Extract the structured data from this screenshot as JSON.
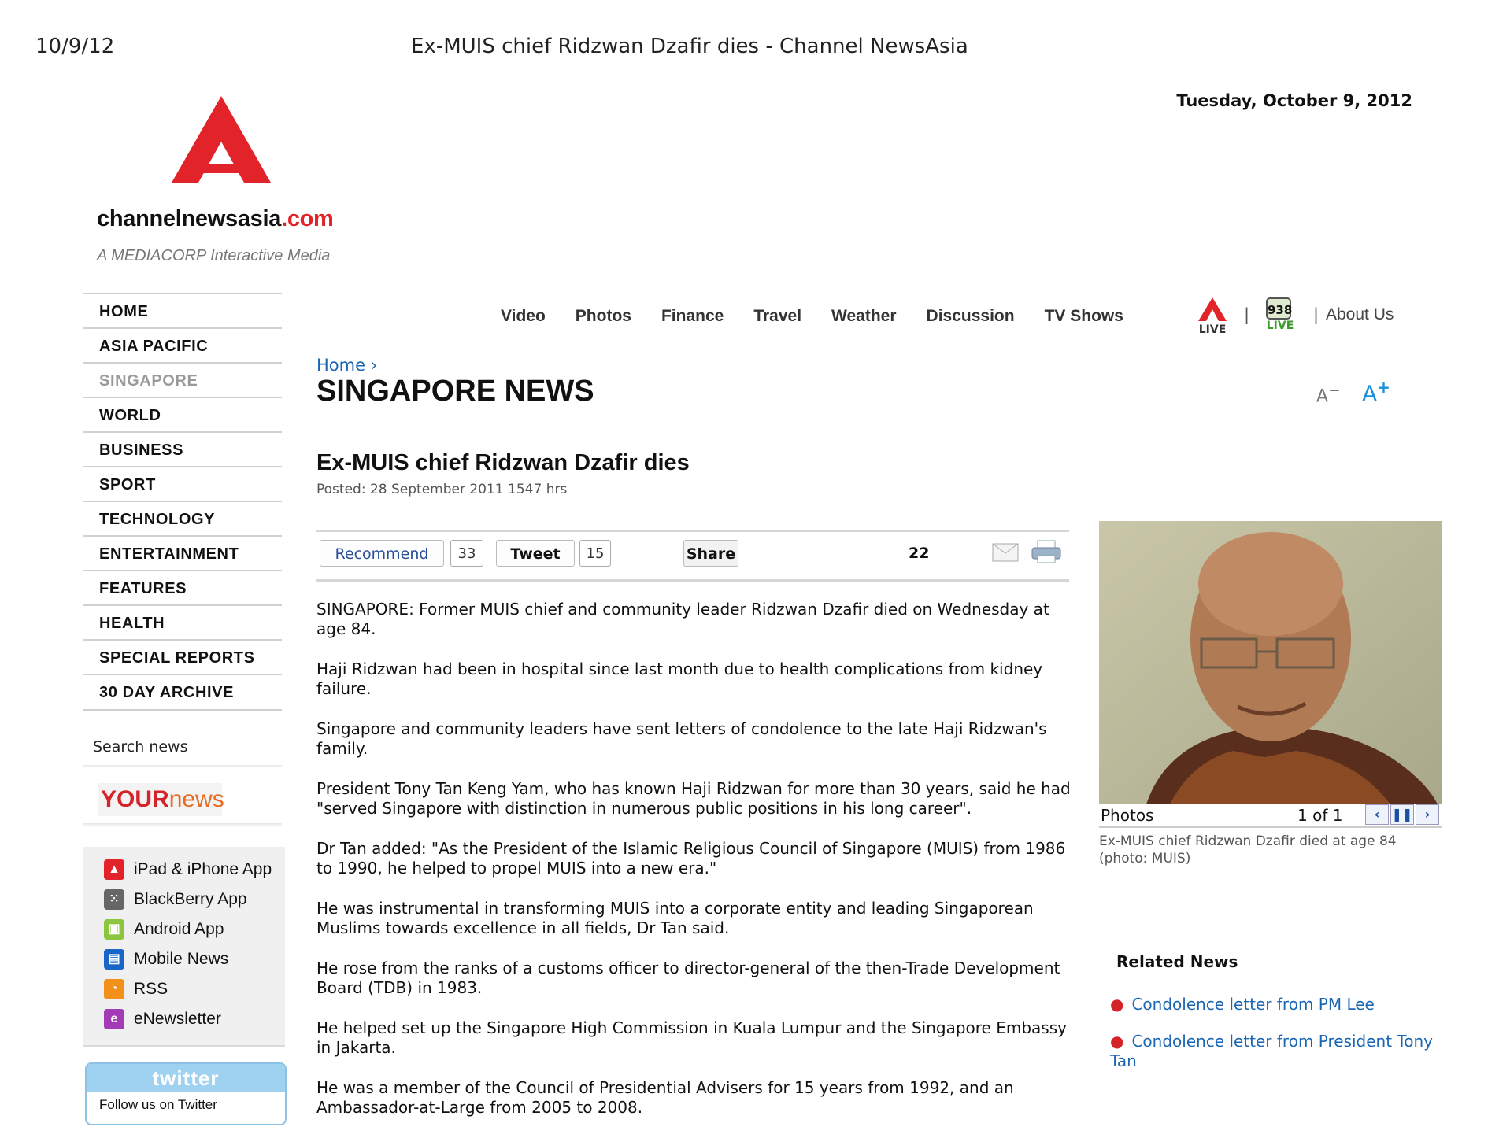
{
  "print_header": {
    "date": "10/9/12",
    "title": "Ex-MUIS chief Ridzwan Dzafir dies - Channel NewsAsia"
  },
  "today": "Tuesday, October 9, 2012",
  "logo": {
    "domain": "channelnewsasia",
    "tld": ".com",
    "tagline": "A MEDIACORP Interactive Media"
  },
  "left_nav": [
    {
      "label": "HOME"
    },
    {
      "label": "ASIA PACIFIC"
    },
    {
      "label": "SINGAPORE"
    },
    {
      "label": "WORLD"
    },
    {
      "label": "BUSINESS"
    },
    {
      "label": "SPORT"
    },
    {
      "label": "TECHNOLOGY"
    },
    {
      "label": "ENTERTAINMENT"
    },
    {
      "label": "FEATURES"
    },
    {
      "label": "HEALTH"
    },
    {
      "label": "SPECIAL REPORTS"
    },
    {
      "label": "30 DAY ARCHIVE"
    }
  ],
  "search_label": "Search news",
  "yournews": {
    "your": "YOUR",
    "news": "news"
  },
  "apps": [
    {
      "label": "iPad & iPhone App",
      "icon": "apple-app-icon",
      "color": "#e2232a"
    },
    {
      "label": "BlackBerry App",
      "icon": "blackberry-icon",
      "color": "#666666"
    },
    {
      "label": "Android App",
      "icon": "android-icon",
      "color": "#8cc63f"
    },
    {
      "label": "Mobile News",
      "icon": "mobile-news-icon",
      "color": "#1a66c8"
    },
    {
      "label": "RSS",
      "icon": "rss-icon",
      "color": "#f39019"
    },
    {
      "label": "eNewsletter",
      "icon": "enewsletter-icon",
      "color": "#a23bb5"
    }
  ],
  "twitter": {
    "brand": "twitter",
    "follow": "Follow us on Twitter"
  },
  "top_nav": [
    "Video",
    "Photos",
    "Finance",
    "Travel",
    "Weather",
    "Discussion",
    "TV Shows"
  ],
  "top_nav_extra": {
    "live1": "LIVE",
    "live2_num": "938",
    "live2": "LIVE",
    "about": "About Us"
  },
  "breadcrumb": "Home ›",
  "section_title": "SINGAPORE NEWS",
  "font_controls": {
    "minus": "A",
    "minus_sign": "−",
    "plus": "A",
    "plus_sign": "+"
  },
  "headline": "Ex-MUIS chief Ridzwan Dzafir dies",
  "posted": "Posted: 28 September 2011 1547 hrs",
  "share": {
    "recommend": "Recommend",
    "recommend_count": "33",
    "tweet": "Tweet",
    "tweet_count": "15",
    "share": "Share",
    "share_count": "22"
  },
  "article": [
    "SINGAPORE: Former MUIS chief and community leader Ridzwan Dzafir died on Wednesday at age 84.",
    "Haji Ridzwan had been in hospital since last month due to health complications from kidney failure.",
    "Singapore and community leaders have sent letters of condolence to the late Haji Ridzwan's family.",
    "President Tony Tan Keng Yam, who has known Haji Ridzwan for more than 30 years, said he had \"served Singapore with distinction in numerous public positions in his long career\".",
    "Dr Tan added: \"As the President of the Islamic Religious Council of Singapore (MUIS) from 1986 to 1990, he helped to propel MUIS into a new era.\"",
    "He was instrumental in transforming MUIS into a corporate entity and leading Singaporean Muslims towards excellence in all fields, Dr Tan said.",
    "He rose from the ranks of a customs officer to director-general of the then-Trade Development Board (TDB) in 1983.",
    "He helped set up the Singapore High Commission in Kuala Lumpur and the Singapore Embassy in Jakarta.",
    "He was a member of the Council of Presidential Advisers for 15 years from 1992, and an Ambassador-at-Large from 2005 to 2008."
  ],
  "photo": {
    "label": "Photos",
    "count": "1 of 1",
    "caption": "Ex-MUIS chief Ridzwan Dzafir died at age 84 (photo: MUIS)"
  },
  "related": {
    "heading": "Related News",
    "items": [
      "Condolence letter from PM Lee",
      "Condolence letter from President Tony Tan"
    ]
  },
  "colors": {
    "brand_red": "#e2232a",
    "link_blue": "#1a66b3"
  }
}
